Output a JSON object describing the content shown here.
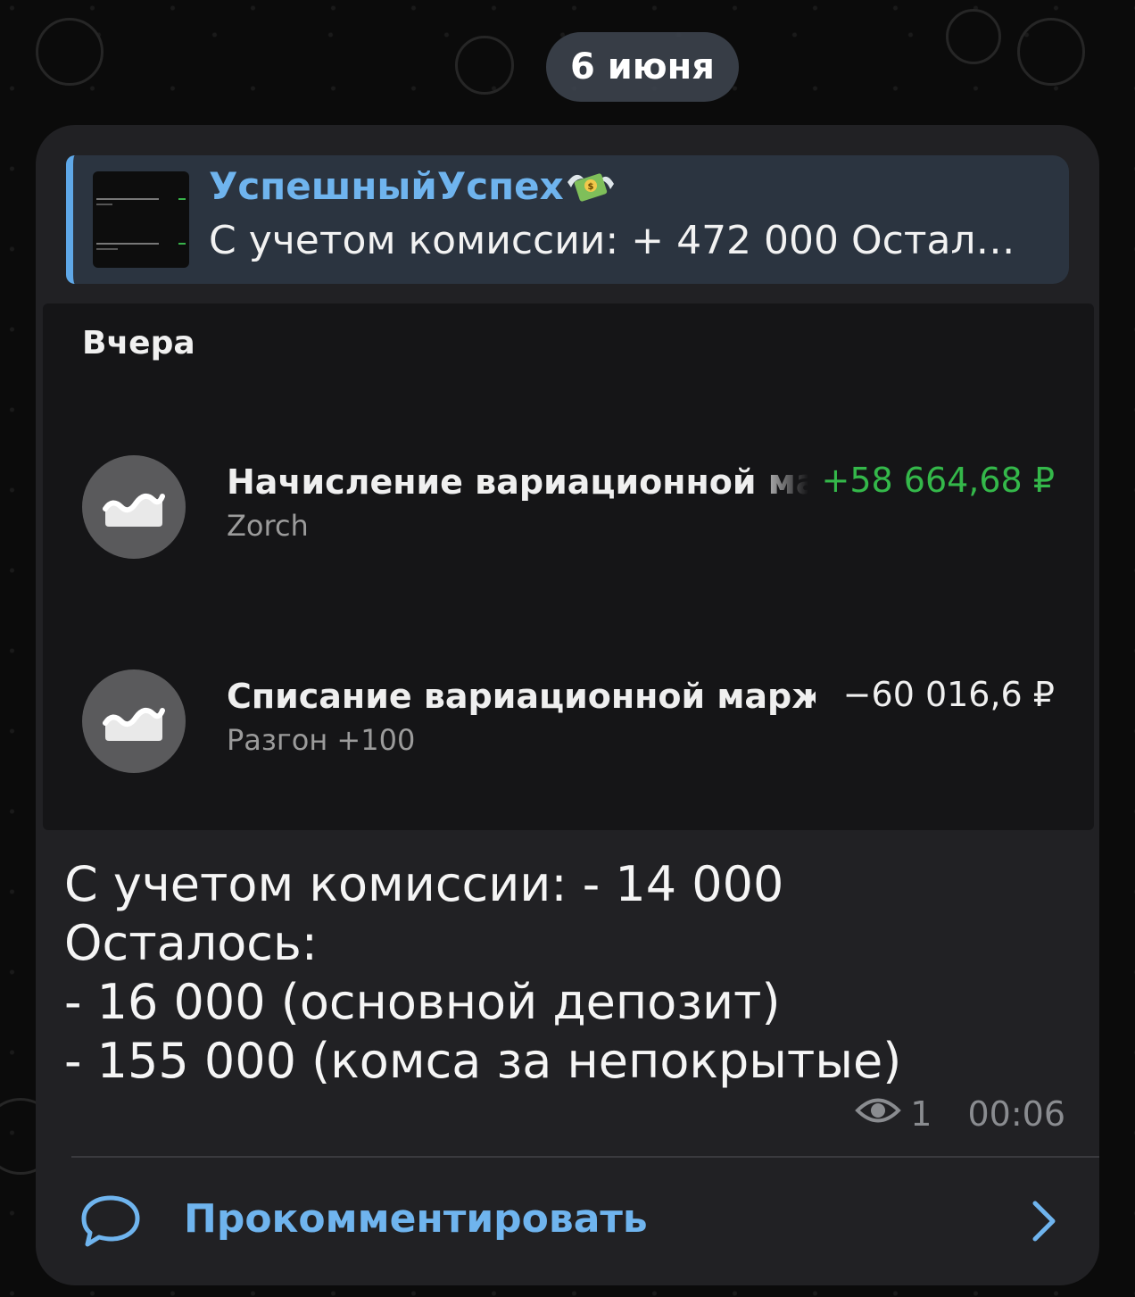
{
  "date_separator": "6 июня",
  "reply": {
    "author": "УспешныйУспех",
    "author_emoji_icon": "money-with-wings-icon",
    "preview_text": "С учетом комиссии: + 472 000 Остал…"
  },
  "statement": {
    "day_label": "Вчера",
    "operations": [
      {
        "title": "Начисление вариационной маржи",
        "subtitle": "Zorch",
        "amount": "+58 664,68 ₽",
        "amount_color": "#34b84a",
        "icon": "trend-chart-icon"
      },
      {
        "title": "Списание вариационной маржи",
        "subtitle": "Разгон +100",
        "amount": "−60 016,6 ₽",
        "amount_color": "#efefef",
        "icon": "trend-chart-icon"
      }
    ]
  },
  "caption_lines": [
    "С учетом комиссии: - 14 000",
    "Осталось:",
    "- 16 000 (основной депозит)",
    "- 155 000 (комса за непокрытые)"
  ],
  "meta": {
    "views": "1",
    "time": "00:06"
  },
  "comment": {
    "label": "Прокомментировать"
  },
  "colors": {
    "accent": "#6fb4ee",
    "bubble": "#212124",
    "reply_bar": "#5fa8e8"
  }
}
